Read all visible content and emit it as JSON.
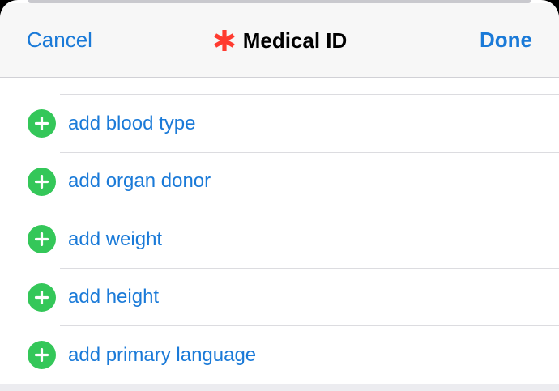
{
  "colors": {
    "accent": "#1a7ad8",
    "plus_green": "#34c759",
    "asterisk_red": "#ff3b30",
    "nav_background": "#f7f7f7"
  },
  "nav": {
    "cancel_label": "Cancel",
    "title": "Medical ID",
    "title_icon": "asterisk-icon",
    "done_label": "Done"
  },
  "items": [
    {
      "label": "add blood type",
      "icon": "plus-circle-icon"
    },
    {
      "label": "add organ donor",
      "icon": "plus-circle-icon"
    },
    {
      "label": "add weight",
      "icon": "plus-circle-icon"
    },
    {
      "label": "add height",
      "icon": "plus-circle-icon"
    },
    {
      "label": "add primary language",
      "icon": "plus-circle-icon"
    }
  ]
}
